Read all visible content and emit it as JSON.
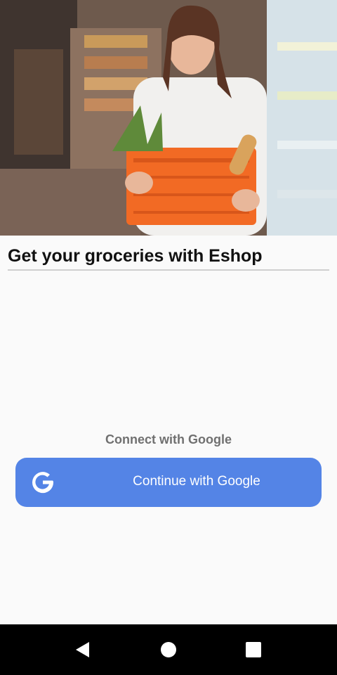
{
  "hero": {
    "image_description_icon": "grocery-shopper-photo"
  },
  "headline": "Get your groceries with Eshop",
  "connect_label": "Connect with Google",
  "google_button": {
    "label": "Continue with Google",
    "icon": "google-g-icon",
    "color": "#5484e6"
  },
  "navbar": {
    "back_icon": "back-triangle-icon",
    "home_icon": "home-circle-icon",
    "recents_icon": "recents-square-icon"
  }
}
